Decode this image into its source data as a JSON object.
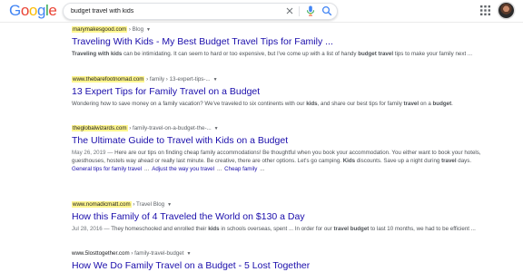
{
  "header": {
    "logo_letters": [
      {
        "ch": "G",
        "color": "#4285F4"
      },
      {
        "ch": "o",
        "color": "#EA4335"
      },
      {
        "ch": "o",
        "color": "#FBBC05"
      },
      {
        "ch": "g",
        "color": "#4285F4"
      },
      {
        "ch": "l",
        "color": "#34A853"
      },
      {
        "ch": "e",
        "color": "#EA4335"
      }
    ],
    "search_query": "budget travel with kids",
    "clear_icon": "close-icon",
    "mic_icon": "microphone-icon",
    "search_icon": "search-icon",
    "apps_icon": "apps-grid-icon"
  },
  "results": [
    {
      "domain": "marymakesgood.com",
      "path": " › Blog",
      "title": "Traveling With Kids - My Best Budget Travel Tips for Family ...",
      "date": "",
      "snippet": [
        {
          "t": "Traveling with kids",
          "b": true
        },
        {
          "t": " can be intimidating. It can seem to hard or too expensive, but I've come up with a list of handy ",
          "b": false
        },
        {
          "t": "budget travel",
          "b": true
        },
        {
          "t": " tips to make your family next ...",
          "b": false
        }
      ],
      "sitelinks": []
    },
    {
      "domain": "www.thebarefootnomad.com",
      "path": " › family › 13-expert-tips-...",
      "title": "13 Expert Tips for Family Travel on a Budget",
      "date": "",
      "snippet": [
        {
          "t": "Wondering how to save money on a family vacation? We've traveled to six continents with our ",
          "b": false
        },
        {
          "t": "kids",
          "b": true
        },
        {
          "t": ", and share our best tips for family ",
          "b": false
        },
        {
          "t": "travel",
          "b": true
        },
        {
          "t": " on a ",
          "b": false
        },
        {
          "t": "budget",
          "b": true
        },
        {
          "t": ".",
          "b": false
        }
      ],
      "sitelinks": []
    },
    {
      "domain": "theglobalwizards.com",
      "path": " › family-travel-on-a-budget-the-...",
      "title": "The Ultimate Guide to Travel with Kids on a Budget",
      "date": "May 26, 2019",
      "snippet": [
        {
          "t": "Here are our tips on finding cheap family accommodations! Be thoughtful when you book your accommodation. You either want to book your hotels, guesthouses, hostels way ahead or really last minute. Be creative, there are other options. Let's go camping. ",
          "b": false
        },
        {
          "t": "Kids",
          "b": true
        },
        {
          "t": " discounts. Save up a night during ",
          "b": false
        },
        {
          "t": "travel",
          "b": true
        },
        {
          "t": " days.",
          "b": false
        }
      ],
      "sitelinks": [
        "General tips for family travel",
        "Adjust the way you travel",
        "Cheap family"
      ]
    },
    {
      "domain": "www.nomadicmatt.com",
      "path": " › Travel Blog",
      "title": "How this Family of 4 Traveled the World on $130 a Day",
      "date": "Jul 28, 2016",
      "snippet": [
        {
          "t": "They homeschooled and enrolled their ",
          "b": false
        },
        {
          "t": "kids",
          "b": true
        },
        {
          "t": " in schools overseas, spent ... In order for our ",
          "b": false
        },
        {
          "t": "travel budget",
          "b": true
        },
        {
          "t": " to last 10 months, we had to be efficient ...",
          "b": false
        }
      ],
      "sitelinks": []
    },
    {
      "domain": "www.5losttogether.com",
      "path": " › family-travel-budget",
      "title": "How We Do Family Travel on a Budget - 5 Lost Together",
      "date": "",
      "snippet": [],
      "sitelinks": []
    }
  ],
  "highlight_color": "#fff68f",
  "link_color": "#1a0dab"
}
